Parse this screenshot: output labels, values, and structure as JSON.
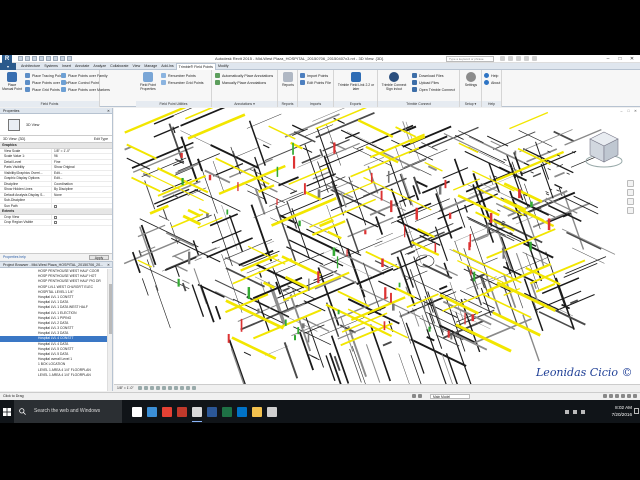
{
  "title_bar": {
    "app_logo": "R",
    "window_title": "Autodesk Revit 2015 -    Mid-West Plaza_HOSPITAL_20150706_20150407x3.rvt - 3D View: {3D}",
    "search_placeholder": "Type a keyword or phrase",
    "controls": [
      "–",
      "□",
      "✕"
    ]
  },
  "ribbon_tabs": {
    "file": "",
    "tabs": [
      "Architecture",
      "Systems",
      "Insert",
      "Annotate",
      "Analyze",
      "Collaborate",
      "View",
      "Manage",
      "Add-Ins",
      "Trimble® Field Points",
      "Modify"
    ],
    "active_index": 9
  },
  "ribbon": {
    "groups": [
      {
        "label": "Field Points",
        "buttons": [
          {
            "label": "Place Manual Point",
            "kind": "big"
          },
          {
            "label": "Place Tracing Points",
            "kind": "small"
          },
          {
            "label": "Place Points over Path",
            "kind": "small"
          },
          {
            "label": "Place Grid Points",
            "kind": "small"
          },
          {
            "label": "Place Points over Family",
            "kind": "small"
          },
          {
            "label": "Place Control Point",
            "kind": "small"
          },
          {
            "label": "Place Points over Markers",
            "kind": "small"
          }
        ]
      },
      {
        "label": "Field Point Utilities",
        "buttons": [
          {
            "label": "Field Point Properties",
            "kind": "big"
          },
          {
            "label": "Renumber Points",
            "kind": "small"
          },
          {
            "label": "Renumber Grid Points",
            "kind": "small"
          }
        ]
      },
      {
        "label": "Annotations ▾",
        "buttons": [
          {
            "label": "Automatically Place Annotations",
            "kind": "small"
          },
          {
            "label": "Manually Place Annotations",
            "kind": "small"
          }
        ]
      },
      {
        "label": "Reports",
        "buttons": [
          {
            "label": "Reports",
            "kind": "big"
          }
        ]
      },
      {
        "label": "Imports",
        "buttons": [
          {
            "label": "Import Points",
            "kind": "small"
          },
          {
            "label": "Edit Points File",
            "kind": "small"
          }
        ]
      },
      {
        "label": "Exports",
        "buttons": [
          {
            "label": "Trimble Field Link 2.2 or later",
            "kind": "big"
          }
        ]
      },
      {
        "label": "Trimble Connect",
        "buttons": [
          {
            "label": "Trimble Connect Sign in/out",
            "kind": "big"
          },
          {
            "label": "Download Files",
            "kind": "small"
          },
          {
            "label": "Upload Files",
            "kind": "small"
          },
          {
            "label": "Open Trimble Connect",
            "kind": "small"
          }
        ]
      },
      {
        "label": "Setup ▾",
        "buttons": [
          {
            "label": "Settings",
            "kind": "big"
          }
        ]
      },
      {
        "label": "Help",
        "buttons": [
          {
            "label": "Help",
            "kind": "small"
          },
          {
            "label": "About",
            "kind": "small"
          }
        ]
      }
    ]
  },
  "properties": {
    "title": "Properties",
    "type_name": "3D View",
    "instance_label": "3D View: {3D}",
    "edit_type": "Edit Type",
    "categories": [
      {
        "name": "Graphics",
        "rows": [
          {
            "key": "View Scale",
            "value": "1/8\" = 1'-0\""
          },
          {
            "key": "Scale Value    1:",
            "value": "96"
          },
          {
            "key": "Detail Level",
            "value": "Fine"
          },
          {
            "key": "Parts Visibility",
            "value": "Show Original"
          },
          {
            "key": "Visibility/Graphics Overri...",
            "value": "Edit..."
          },
          {
            "key": "Graphic Display Options",
            "value": "Edit..."
          },
          {
            "key": "Discipline",
            "value": "Coordination"
          },
          {
            "key": "Show Hidden Lines",
            "value": "By Discipline"
          },
          {
            "key": "Default Analysis Display S...",
            "value": "None"
          },
          {
            "key": "Sub-Discipline",
            "value": ""
          },
          {
            "key": "Sun Path",
            "value": "checkbox"
          }
        ]
      },
      {
        "name": "Extents",
        "rows": [
          {
            "key": "Crop View",
            "value": "checkbox"
          },
          {
            "key": "Crop Region Visible",
            "value": "checkbox"
          }
        ]
      }
    ],
    "help_link": "Properties help",
    "apply": "Apply"
  },
  "project_browser": {
    "title": "Project Browser - Mid-West Plaza_HOSPITAL_20150706_20...",
    "items": [
      "HOSP PENTHOUSE WEST HALF COOR",
      "HOSP PENTHOUSE WEST HALF HOT",
      "HOSP PENTHOUSE WEST HALF PIG DR",
      "HOSP LVL1 WEST CHLRGR'T ELEC",
      "HOSPITAL LEVEL1 1/4\"",
      "Hospital LVL 1 CONSTT",
      "Hospital LVL 1 DATA",
      "Hospital LVL 1 DATA WEST HALF",
      "Hospital LVL 1 ELECTION",
      "Hospital LVL 1 PIPING",
      "Hospital LVL 2 DATA",
      "Hospital LVL 3 CONSTT",
      "Hospital LVL 3 DATA",
      "Hospital LVL 4 CONSTT",
      "Hospital LVL 4 DATA",
      "Hospital LVL 5 CONSTT",
      "Hospital LVL 5 DATA",
      "Hospital overall Level 1",
      "1 BOX LOCATION",
      "LEVEL 1 AREA 4 1/4\" FLOORPLAN",
      "LEVEL 1 AREA 4 1/4\" FLOORPLAN"
    ],
    "selected_index": 13
  },
  "viewport": {
    "scale": "1/8\" = 1'-0\"",
    "signature": "Leonidas Cicio ©"
  },
  "status_bar": {
    "text": "Click to select, TAB for alternates, CTRL adds, SHIFT unselects.",
    "short_text": "Click to Drag",
    "main_model": "Main Model"
  },
  "taskbar": {
    "search_text": "Search the web and Windows",
    "time": "8:02 AM",
    "date": "7/20/2016",
    "apps": [
      {
        "name": "task-view",
        "color": "#ffffff"
      },
      {
        "name": "edge",
        "color": "#3b8fd6"
      },
      {
        "name": "chrome",
        "color": "#e44134"
      },
      {
        "name": "acrobat",
        "color": "#c0392b"
      },
      {
        "name": "revit",
        "color": "#d8d8d8"
      },
      {
        "name": "word",
        "color": "#2b5797"
      },
      {
        "name": "excel",
        "color": "#1e7145"
      },
      {
        "name": "outlook",
        "color": "#0072c6"
      },
      {
        "name": "explorer",
        "color": "#f2c14e"
      },
      {
        "name": "settings",
        "color": "#cfcfcf"
      }
    ]
  }
}
